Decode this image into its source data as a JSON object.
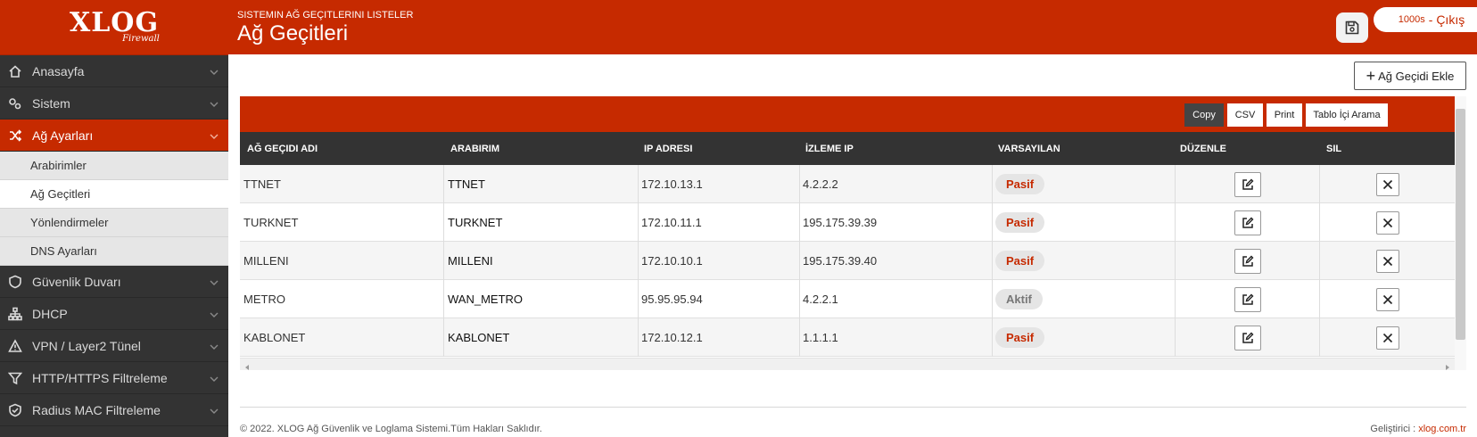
{
  "logo": {
    "main": "XLOG",
    "sub": "Firewall"
  },
  "header": {
    "subtitle": "SISTEMIN AĞ GEÇITLERINI LISTELER",
    "title": "Ağ Geçitleri",
    "session_count": "1000s",
    "logout_label": "- Çıkış"
  },
  "sidebar": {
    "items": [
      {
        "label": "Anasayfa",
        "icon": "home-icon"
      },
      {
        "label": "Sistem",
        "icon": "gears-icon"
      },
      {
        "label": "Ağ Ayarları",
        "icon": "shuffle-icon",
        "active": true
      },
      {
        "label": "Güvenlik Duvarı",
        "icon": "shield-icon"
      },
      {
        "label": "DHCP",
        "icon": "sitemap-icon"
      },
      {
        "label": "VPN / Layer2 Tünel",
        "icon": "warning-icon"
      },
      {
        "label": "HTTP/HTTPS Filtreleme",
        "icon": "filter-icon"
      },
      {
        "label": "Radius MAC Filtreleme",
        "icon": "shield-check-icon"
      }
    ],
    "subitems": [
      {
        "label": "Arabirimler"
      },
      {
        "label": "Ağ Geçitleri",
        "current": true
      },
      {
        "label": "Yönlendirmeler"
      },
      {
        "label": "DNS Ayarları"
      }
    ]
  },
  "main": {
    "add_button": "Ağ Geçidi Ekle",
    "toolbar": {
      "copy": "Copy",
      "csv": "CSV",
      "print": "Print",
      "search": "Tablo İçi Arama"
    },
    "columns": [
      "AĞ GEÇIDI ADI",
      "ARABIRIM",
      "IP ADRESI",
      "İZLEME IP",
      "VARSAYILAN",
      "DÜZENLE",
      "SIL"
    ],
    "rows": [
      {
        "name": "TTNET",
        "iface": "TTNET",
        "ip": "172.10.13.1",
        "monitor": "4.2.2.2",
        "default": "Pasif"
      },
      {
        "name": "TURKNET",
        "iface": "TURKNET",
        "ip": "172.10.11.1",
        "monitor": "195.175.39.39",
        "default": "Pasif"
      },
      {
        "name": "MILLENI",
        "iface": "MILLENI",
        "ip": "172.10.10.1",
        "monitor": "195.175.39.40",
        "default": "Pasif"
      },
      {
        "name": "METRO",
        "iface": "WAN_METRO",
        "ip": "95.95.95.94",
        "monitor": "4.2.2.1",
        "default": "Aktif"
      },
      {
        "name": "KABLONET",
        "iface": "KABLONET",
        "ip": "172.10.12.1",
        "monitor": "1.1.1.1",
        "default": "Pasif"
      }
    ]
  },
  "footer": {
    "copyright": "© 2022. XLOG Ağ Güvenlik ve Loglama Sistemi.Tüm Hakları Saklıdır.",
    "dev_label": "Geliştirici :",
    "dev_link": "xlog.com.tr"
  },
  "colors": {
    "brand": "#c62a00",
    "sidebar": "#333333",
    "header_row": "#333333"
  }
}
